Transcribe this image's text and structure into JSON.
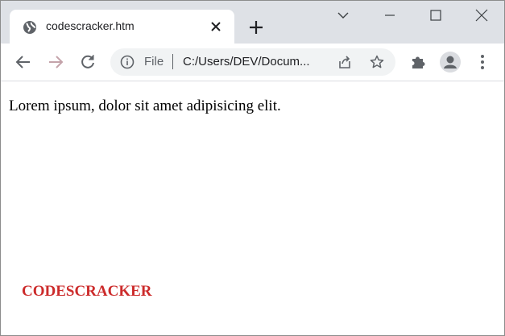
{
  "browser": {
    "tab": {
      "title": "codescracker.htm",
      "favicon": "globe-icon"
    },
    "window_controls": [
      "chevron-down-icon",
      "minimize-icon",
      "maximize-icon",
      "close-icon"
    ],
    "toolbar": {
      "back_icon": "back-arrow-icon",
      "forward_icon": "forward-arrow-icon",
      "reload_icon": "reload-icon",
      "omnibox": {
        "scheme_label": "File",
        "url": "C:/Users/DEV/Docum..."
      },
      "extensions_icon": "puzzle-icon",
      "profile_icon": "person-icon",
      "menu_icon": "kebab-menu-icon"
    }
  },
  "page": {
    "paragraph": "Lorem ipsum, dolor sit amet adipisicing elit.",
    "brand_text": "CODESCRACKER",
    "brand_color": "#cc2b2b"
  }
}
